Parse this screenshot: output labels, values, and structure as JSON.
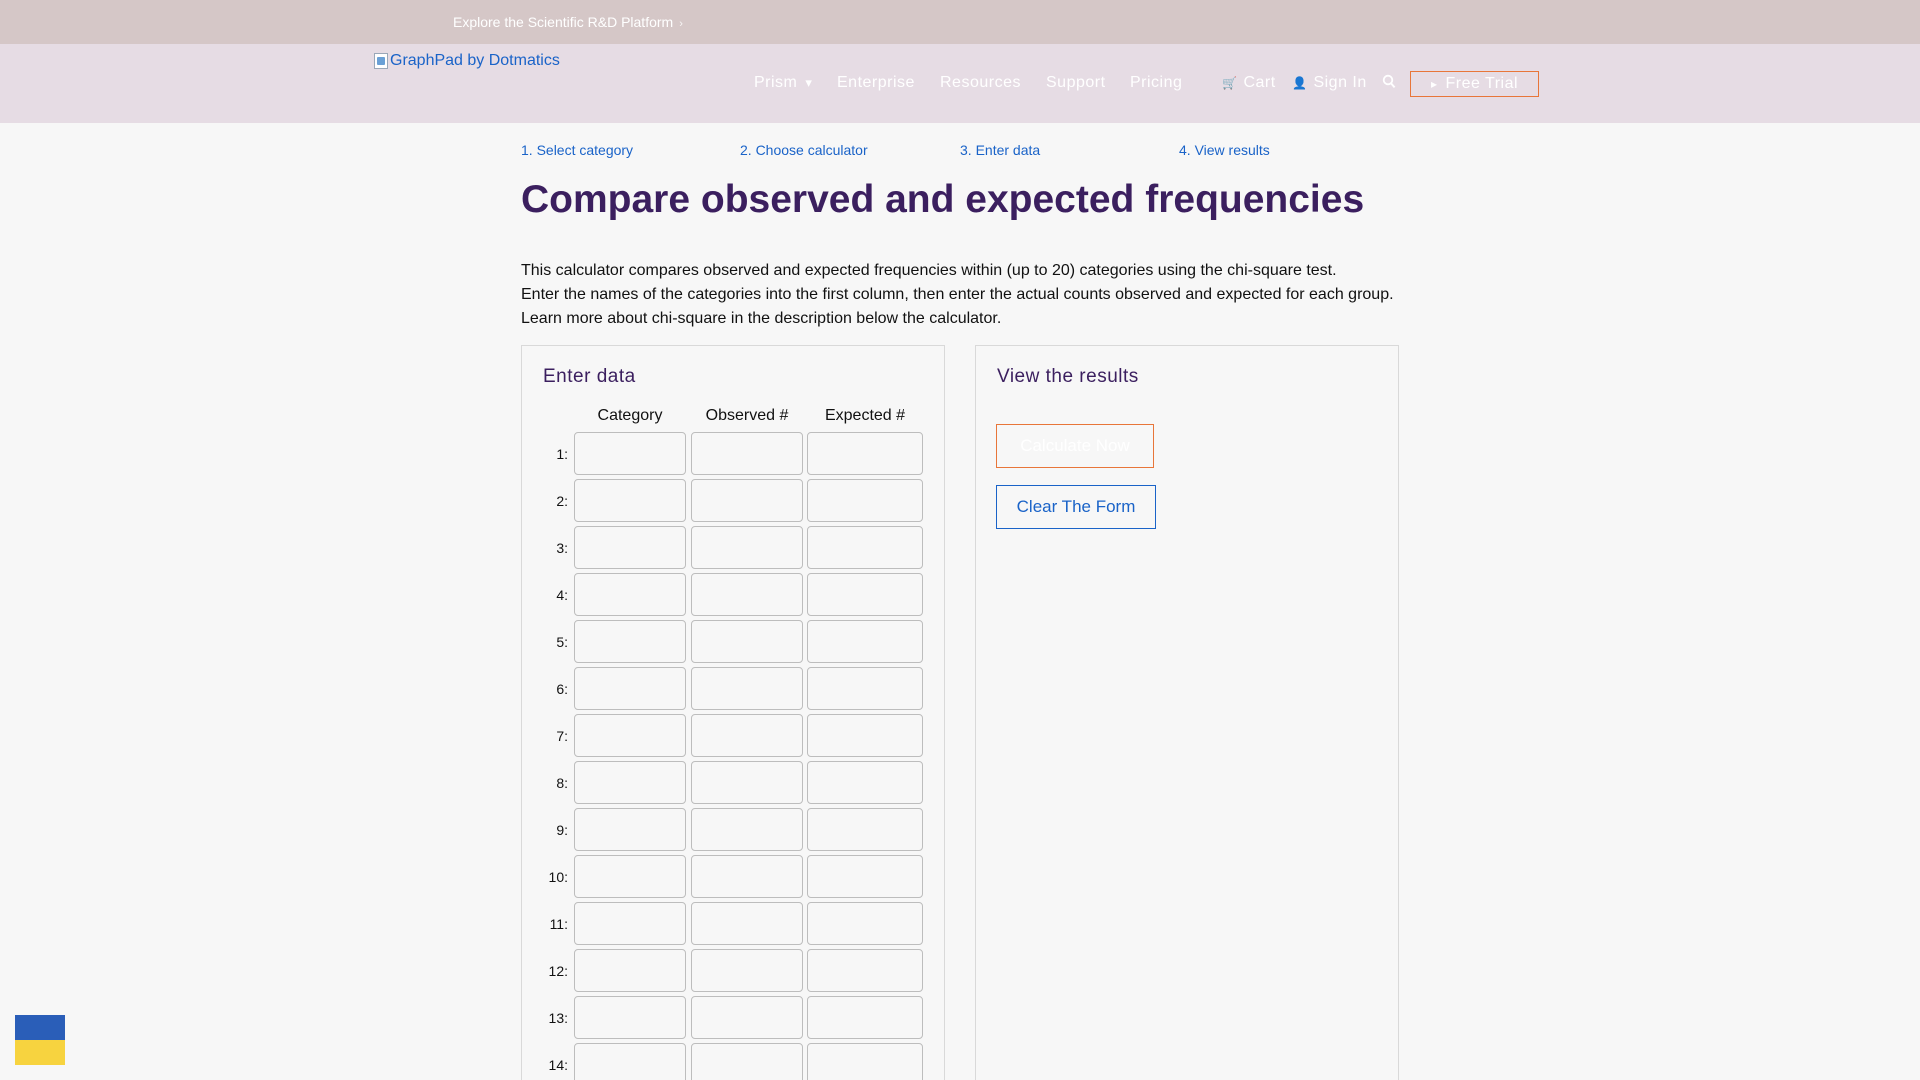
{
  "topbar": {
    "promo": "Explore the Scientific R&D Platform",
    "promo_glyph": "›"
  },
  "header": {
    "logo_alt": "GraphPad by Dotmatics",
    "nav": {
      "prism": "Prism",
      "prism_caret": "▾",
      "enterprise": "Enterprise",
      "resources": "Resources",
      "support": "Support",
      "pricing": "Pricing",
      "cart_icon": "🛒",
      "cart": "Cart",
      "signin_icon": "👤",
      "signin": "Sign In",
      "trial_icon": "▸",
      "free_trial": "Free Trial"
    },
    "icons": [
      "broken-image-icon",
      "cart-icon",
      "user-icon",
      "search-icon",
      "play-icon"
    ]
  },
  "steps": [
    "1. Select category",
    "2. Choose calculator",
    "3. Enter data",
    "4. View results"
  ],
  "page": {
    "title": "Compare observed and expected frequencies",
    "intro": [
      "This calculator compares observed and expected frequencies within (up to 20) categories using the chi-square test.",
      "Enter the names of the categories into the first column, then enter the actual counts observed and expected for each group.",
      "Learn more about chi-square in the description below the calculator."
    ]
  },
  "enter_panel": {
    "title": "Enter data",
    "columns": [
      "Category",
      "Observed #",
      "Expected #"
    ],
    "rows": [
      "1:",
      "2:",
      "3:",
      "4:",
      "5:",
      "6:",
      "7:",
      "8:",
      "9:",
      "10:",
      "11:",
      "12:",
      "13:",
      "14:"
    ],
    "cells": [
      [
        "",
        "",
        ""
      ],
      [
        "",
        "",
        ""
      ],
      [
        "",
        "",
        ""
      ],
      [
        "",
        "",
        ""
      ],
      [
        "",
        "",
        ""
      ],
      [
        "",
        "",
        ""
      ],
      [
        "",
        "",
        ""
      ],
      [
        "",
        "",
        ""
      ],
      [
        "",
        "",
        ""
      ],
      [
        "",
        "",
        ""
      ],
      [
        "",
        "",
        ""
      ],
      [
        "",
        "",
        ""
      ],
      [
        "",
        "",
        ""
      ],
      [
        "",
        "",
        ""
      ]
    ]
  },
  "results_panel": {
    "title": "View the results",
    "calculate_label": "Calculate Now",
    "clear_label": "Clear The Form"
  },
  "colors": {
    "topbar_bg": "#d5c7c7",
    "navbar_bg": "#e6dce4",
    "heading_purple": "#3b1f5f",
    "link_blue": "#1a63c8",
    "accent_orange": "#e8763a",
    "flag_blue": "#2a5eb8",
    "flag_yellow": "#f7d33f"
  }
}
